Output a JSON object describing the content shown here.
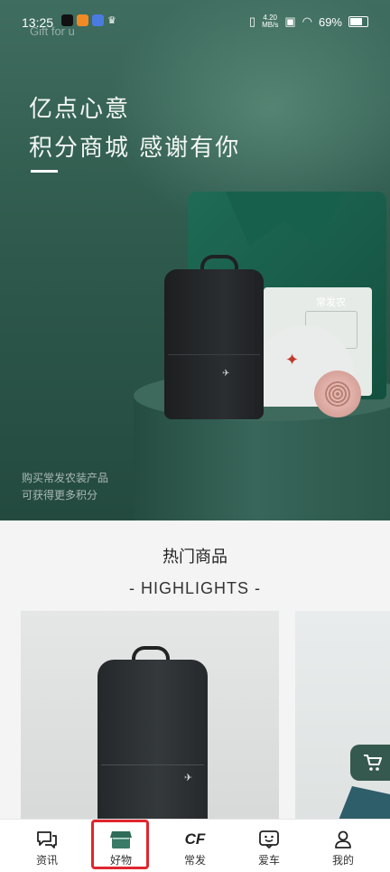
{
  "status_bar": {
    "time": "13:25",
    "net_speed_top": "4.20",
    "net_speed_bottom": "MB/s",
    "battery": "69%"
  },
  "hero": {
    "tagline": "Gift for u",
    "title_line1": "亿点心意",
    "title_line2": "积分商城 感谢有你",
    "caption_line1": "购买常发农装产品",
    "caption_line2": "可获得更多积分",
    "shirt_logo": "常发农"
  },
  "highlights": {
    "title": "热门商品",
    "subtitle": "- HIGHLIGHTS -"
  },
  "bottom_nav": {
    "items": [
      {
        "label": "资讯",
        "icon": "chat-icon"
      },
      {
        "label": "好物",
        "icon": "shop-icon"
      },
      {
        "label": "常发",
        "icon": "cf-logo-icon"
      },
      {
        "label": "爱车",
        "icon": "smile-icon"
      },
      {
        "label": "我的",
        "icon": "person-icon"
      }
    ],
    "active_index": 1,
    "cf_logo_text": "CF"
  },
  "colors": {
    "accent_green": "#2f5a4d",
    "highlight_red": "#e0262e"
  }
}
